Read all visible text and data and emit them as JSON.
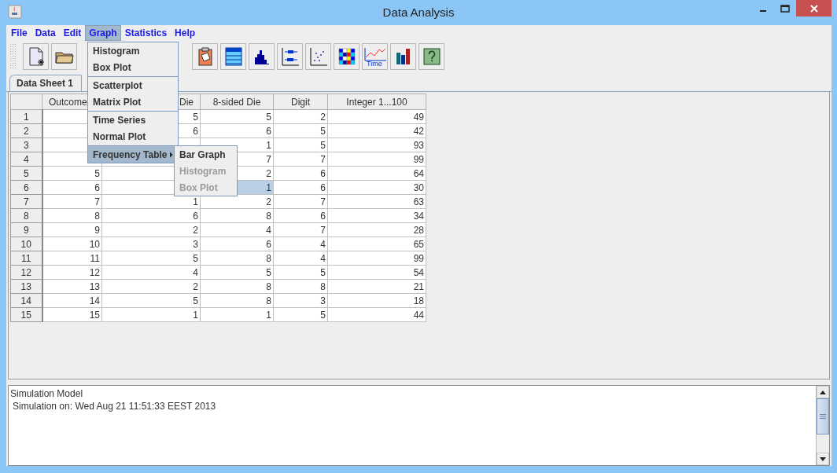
{
  "window": {
    "title": "Data Analysis"
  },
  "menu_bar": [
    {
      "label": "File",
      "selected": false
    },
    {
      "label": "Data",
      "selected": false
    },
    {
      "label": "Edit",
      "selected": false
    },
    {
      "label": "Graph",
      "selected": true
    },
    {
      "label": "Statistics",
      "selected": false
    },
    {
      "label": "Help",
      "selected": false
    }
  ],
  "graph_menu": {
    "groups": [
      [
        {
          "label": "Histogram",
          "selected": false,
          "has_submenu": false
        },
        {
          "label": "Box Plot",
          "selected": false,
          "has_submenu": false
        }
      ],
      [
        {
          "label": "Scatterplot",
          "selected": false,
          "has_submenu": false
        },
        {
          "label": "Matrix Plot",
          "selected": false,
          "has_submenu": false
        }
      ],
      [
        {
          "label": "Time Series",
          "selected": false,
          "has_submenu": false
        },
        {
          "label": "Normal Plot",
          "selected": false,
          "has_submenu": false
        }
      ],
      [
        {
          "label": "Frequency Table",
          "selected": true,
          "has_submenu": true
        }
      ]
    ],
    "submenu": [
      {
        "label": "Bar Graph",
        "disabled": false
      },
      {
        "label": "Histogram",
        "disabled": true
      },
      {
        "label": "Box Plot",
        "disabled": true
      }
    ]
  },
  "toolbar_left": [
    {
      "kind": "new"
    },
    {
      "kind": "open"
    }
  ],
  "toolbar_right": [
    {
      "kind": "clipboard"
    },
    {
      "kind": "table"
    },
    {
      "kind": "histogram"
    },
    {
      "kind": "boxplot"
    },
    {
      "kind": "scatter"
    },
    {
      "kind": "matrix"
    },
    {
      "kind": "timeseries",
      "label": "Time"
    },
    {
      "kind": "bars"
    },
    {
      "kind": "help"
    }
  ],
  "tabs": [
    {
      "label": "Data Sheet 1",
      "selected": true
    }
  ],
  "table": {
    "columns": [
      "Outcome",
      "Die",
      "8-sided Die",
      "Digit",
      "Integer 1...100"
    ],
    "rows": [
      {
        "header": "1",
        "cells": [
          null,
          {
            "text": "5",
            "selected": false
          },
          {
            "text": "5",
            "selected": false
          },
          {
            "text": "2",
            "selected": false
          },
          {
            "text": "49",
            "selected": false
          }
        ]
      },
      {
        "header": "2",
        "cells": [
          null,
          {
            "text": "6",
            "selected": false
          },
          {
            "text": "6",
            "selected": false
          },
          {
            "text": "5",
            "selected": false
          },
          {
            "text": "42",
            "selected": false
          }
        ]
      },
      {
        "header": "3",
        "cells": [
          null,
          null,
          {
            "text": "1",
            "selected": false
          },
          {
            "text": "5",
            "selected": false
          },
          {
            "text": "93",
            "selected": false
          }
        ]
      },
      {
        "header": "4",
        "cells": [
          null,
          null,
          {
            "text": "7",
            "selected": false
          },
          {
            "text": "7",
            "selected": false
          },
          {
            "text": "99",
            "selected": false
          }
        ]
      },
      {
        "header": "5",
        "cells": [
          {
            "text": "5",
            "selected": false
          },
          null,
          {
            "text": "2",
            "selected": false
          },
          {
            "text": "6",
            "selected": false
          },
          {
            "text": "64",
            "selected": false
          }
        ]
      },
      {
        "header": "6",
        "cells": [
          {
            "text": "6",
            "selected": false
          },
          null,
          {
            "text": "1",
            "selected": true
          },
          {
            "text": "6",
            "selected": false
          },
          {
            "text": "30",
            "selected": false
          }
        ]
      },
      {
        "header": "7",
        "cells": [
          {
            "text": "7",
            "selected": false
          },
          {
            "text": "1",
            "selected": false
          },
          {
            "text": "2",
            "selected": false
          },
          {
            "text": "7",
            "selected": false
          },
          {
            "text": "63",
            "selected": false
          }
        ]
      },
      {
        "header": "8",
        "cells": [
          {
            "text": "8",
            "selected": false
          },
          {
            "text": "6",
            "selected": false
          },
          {
            "text": "8",
            "selected": false
          },
          {
            "text": "6",
            "selected": false
          },
          {
            "text": "34",
            "selected": false
          }
        ]
      },
      {
        "header": "9",
        "cells": [
          {
            "text": "9",
            "selected": false
          },
          {
            "text": "2",
            "selected": false
          },
          {
            "text": "4",
            "selected": false
          },
          {
            "text": "7",
            "selected": false
          },
          {
            "text": "28",
            "selected": false
          }
        ]
      },
      {
        "header": "10",
        "cells": [
          {
            "text": "10",
            "selected": false
          },
          {
            "text": "3",
            "selected": false
          },
          {
            "text": "6",
            "selected": false
          },
          {
            "text": "4",
            "selected": false
          },
          {
            "text": "65",
            "selected": false
          }
        ]
      },
      {
        "header": "11",
        "cells": [
          {
            "text": "11",
            "selected": false
          },
          {
            "text": "5",
            "selected": false
          },
          {
            "text": "8",
            "selected": false
          },
          {
            "text": "4",
            "selected": false
          },
          {
            "text": "99",
            "selected": false
          }
        ]
      },
      {
        "header": "12",
        "cells": [
          {
            "text": "12",
            "selected": false
          },
          {
            "text": "4",
            "selected": false
          },
          {
            "text": "5",
            "selected": false
          },
          {
            "text": "5",
            "selected": false
          },
          {
            "text": "54",
            "selected": false
          }
        ]
      },
      {
        "header": "13",
        "cells": [
          {
            "text": "13",
            "selected": false
          },
          {
            "text": "2",
            "selected": false
          },
          {
            "text": "8",
            "selected": false
          },
          {
            "text": "8",
            "selected": false
          },
          {
            "text": "21",
            "selected": false
          }
        ]
      },
      {
        "header": "14",
        "cells": [
          {
            "text": "14",
            "selected": false
          },
          {
            "text": "5",
            "selected": false
          },
          {
            "text": "8",
            "selected": false
          },
          {
            "text": "3",
            "selected": false
          },
          {
            "text": "18",
            "selected": false
          }
        ]
      },
      {
        "header": "15",
        "cells": [
          {
            "text": "15",
            "selected": false
          },
          {
            "text": "1",
            "selected": false
          },
          {
            "text": "1",
            "selected": false
          },
          {
            "text": "5",
            "selected": false
          },
          {
            "text": "44",
            "selected": false
          }
        ]
      }
    ]
  },
  "log": {
    "title": "Simulation Model",
    "lines": [
      "Simulation on: Wed Aug 21 11:51:33 EEST 2013"
    ]
  }
}
